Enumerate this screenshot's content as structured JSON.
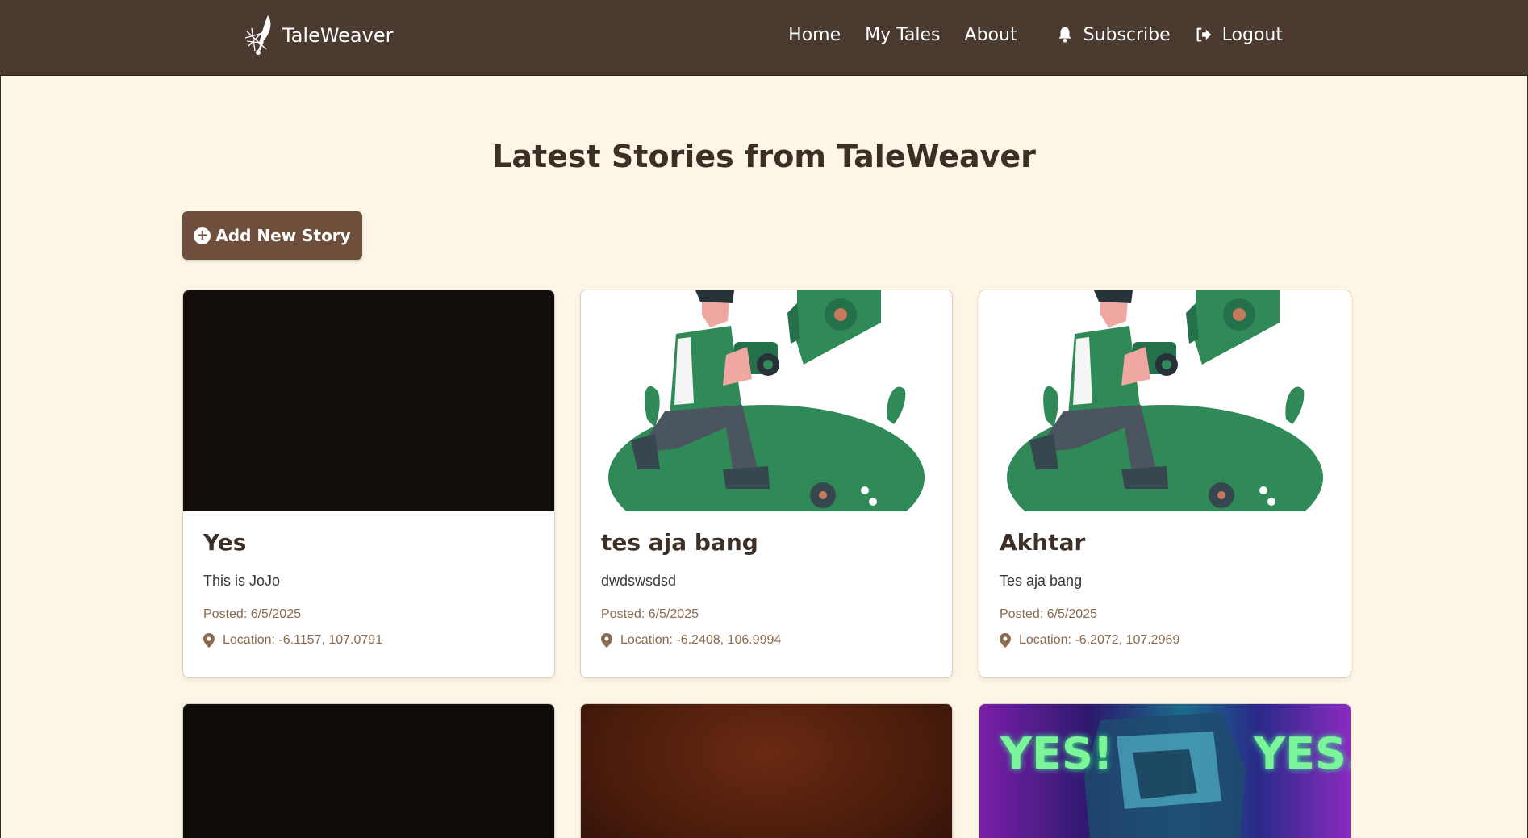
{
  "brand": {
    "name": "TaleWeaver",
    "logo_icon": "quill-icon"
  },
  "nav": {
    "home": "Home",
    "my_tales": "My Tales",
    "about": "About",
    "subscribe": "Subscribe",
    "logout": "Logout"
  },
  "page": {
    "title": "Latest Stories from TaleWeaver",
    "add_button": "Add New Story"
  },
  "stories": [
    {
      "title": "Yes",
      "description": "This is JoJo",
      "posted": "Posted: 6/5/2025",
      "location": "Location: -6.1157, 107.0791",
      "image": "dark photo"
    },
    {
      "title": "tes aja bang",
      "description": "dwdswsdsd",
      "posted": "Posted: 6/5/2025",
      "location": "Location: -6.2408, 106.9994",
      "image": "photographer illustration"
    },
    {
      "title": "Akhtar",
      "description": "Tes aja bang",
      "posted": "Posted: 6/5/2025",
      "location": "Location: -6.2072, 107.2969",
      "image": "photographer illustration"
    }
  ],
  "lower_cards": [
    {
      "image": "dark photo"
    },
    {
      "image": "brown photo"
    },
    {
      "image": "neon portrait",
      "overlay_text_left": "YES!",
      "overlay_text_right": "YES."
    }
  ],
  "colors": {
    "navbar": "#4a3a30",
    "page_bg": "#fdf6e6",
    "button": "#6d4f3b",
    "muted_text": "#8b6b4e",
    "illustration_green": "#2f8a57"
  }
}
